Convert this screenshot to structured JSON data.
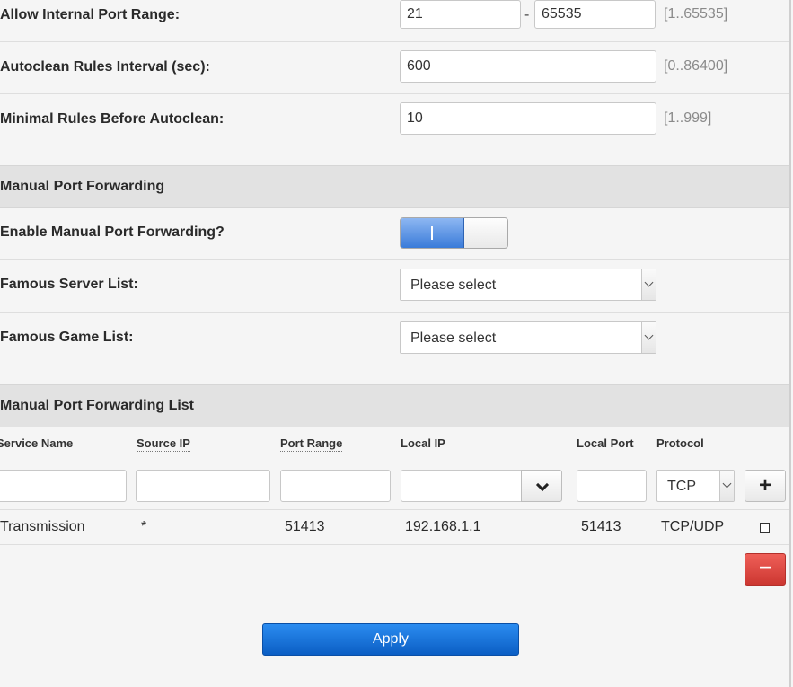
{
  "settings": {
    "internal_port_range": {
      "label": "Allow Internal Port Range:",
      "from": "21",
      "dash": "-",
      "to": "65535",
      "hint": "[1..65535]"
    },
    "autoclean_interval": {
      "label": "Autoclean Rules Interval (sec):",
      "value": "600",
      "hint": "[0..86400]"
    },
    "min_rules": {
      "label": "Minimal Rules Before Autoclean:",
      "value": "10",
      "hint": "[1..999]"
    }
  },
  "manual_forwarding": {
    "section_title": "Manual Port Forwarding",
    "enable_label": "Enable Manual Port Forwarding?",
    "enabled": true,
    "server_list_label": "Famous Server List:",
    "server_list_value": "Please select",
    "game_list_label": "Famous Game List:",
    "game_list_value": "Please select"
  },
  "forwarding_list": {
    "section_title": "Manual Port Forwarding List",
    "columns": [
      "Service Name",
      "Source IP",
      "Port Range",
      "Local IP",
      "Local Port",
      "Protocol"
    ],
    "new_row": {
      "protocol": "TCP"
    },
    "rows": [
      {
        "service": "Transmission",
        "source_ip": "*",
        "port_range": "51413",
        "local_ip": "192.168.1.1",
        "local_port": "51413",
        "protocol": "TCP/UDP"
      }
    ]
  },
  "actions": {
    "apply": "Apply",
    "add": "+",
    "remove": "−"
  },
  "colors": {
    "toggle_on": "#3a7bd9",
    "remove_button": "#d9403a",
    "apply_button": "#0b5ec4",
    "section_bg": "#e2e2e2"
  }
}
